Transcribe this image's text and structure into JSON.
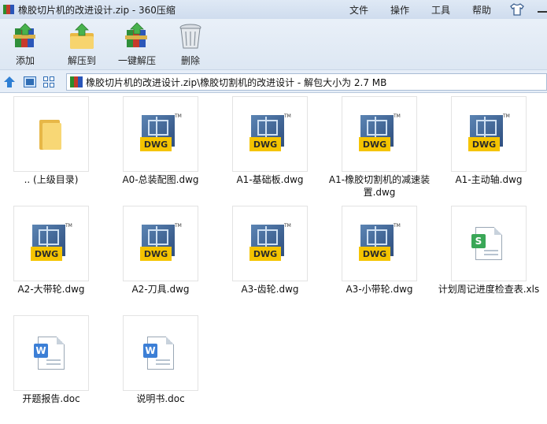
{
  "window": {
    "title": "橡胶切片机的改进设计.zip - 360压缩"
  },
  "menu": {
    "file": "文件",
    "operation": "操作",
    "tools": "工具",
    "help": "帮助"
  },
  "toolbar": {
    "add": "添加",
    "extract_to": "解压到",
    "one_click_extract": "一键解压",
    "delete": "删除"
  },
  "address": {
    "path": "橡胶切片机的改进设计.zip\\橡胶切割机的改进设计 - 解包大小为 2.7 MB"
  },
  "files": [
    {
      "name": ".. (上级目录)",
      "type": "folder"
    },
    {
      "name": "A0-总装配图.dwg",
      "type": "dwg"
    },
    {
      "name": "A1-基础板.dwg",
      "type": "dwg"
    },
    {
      "name": "A1-橡胶切割机的减速装置.dwg",
      "type": "dwg"
    },
    {
      "name": "A1-主动轴.dwg",
      "type": "dwg"
    },
    {
      "name": "A2-大带轮.dwg",
      "type": "dwg"
    },
    {
      "name": "A2-刀具.dwg",
      "type": "dwg"
    },
    {
      "name": "A3-齿轮.dwg",
      "type": "dwg"
    },
    {
      "name": "A3-小带轮.dwg",
      "type": "dwg"
    },
    {
      "name": "计划周记进度检查表.xls",
      "type": "xls"
    },
    {
      "name": "开题报告.doc",
      "type": "doc"
    },
    {
      "name": "说明书.doc",
      "type": "doc"
    }
  ],
  "icons": {
    "dwg_label": "DWG",
    "dwg_tm": "TM",
    "xls_label": "S",
    "doc_label": "W"
  }
}
